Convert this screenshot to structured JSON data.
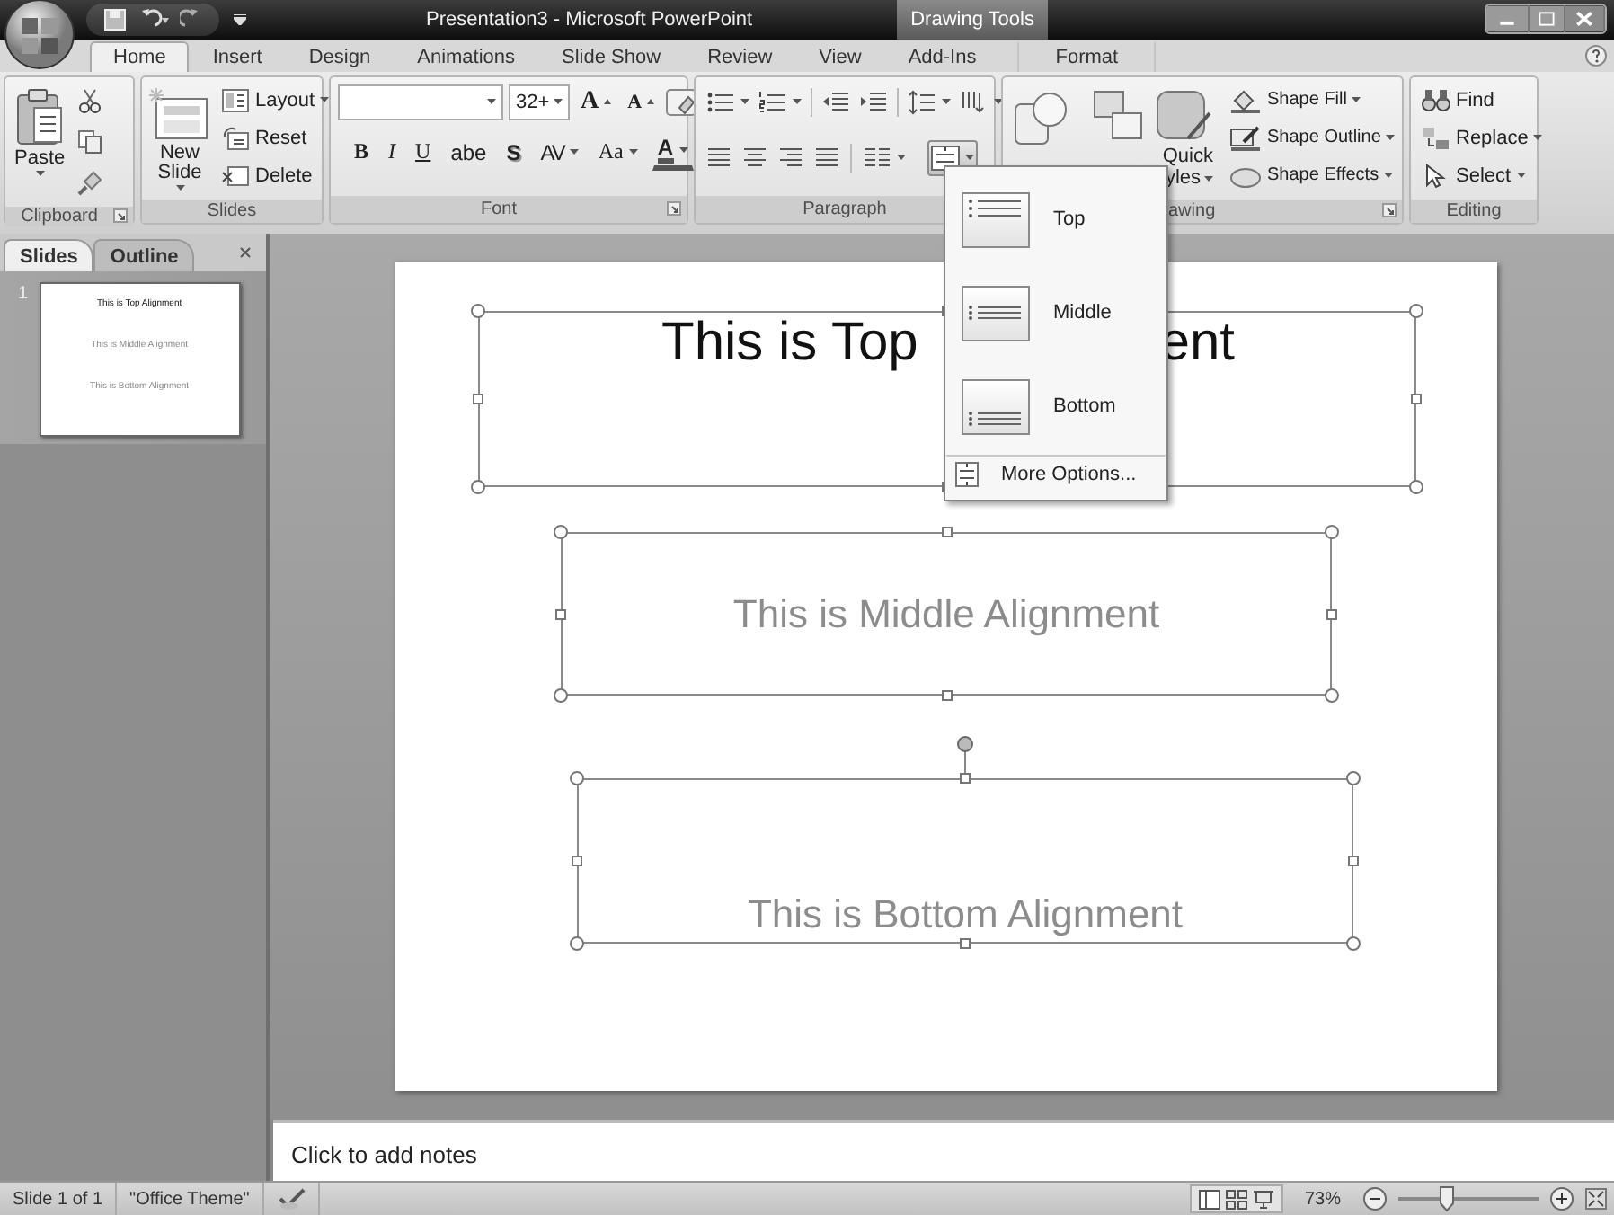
{
  "window": {
    "title": "Presentation3 - Microsoft PowerPoint",
    "context_tab": "Drawing Tools"
  },
  "tabs": [
    {
      "label": "Home",
      "selected": true,
      "contextual": false
    },
    {
      "label": "Insert",
      "selected": false,
      "contextual": false
    },
    {
      "label": "Design",
      "selected": false,
      "contextual": false
    },
    {
      "label": "Animations",
      "selected": false,
      "contextual": false
    },
    {
      "label": "Slide Show",
      "selected": false,
      "contextual": false
    },
    {
      "label": "Review",
      "selected": false,
      "contextual": false
    },
    {
      "label": "View",
      "selected": false,
      "contextual": false
    },
    {
      "label": "Add-Ins",
      "selected": false,
      "contextual": false
    },
    {
      "label": "Format",
      "selected": false,
      "contextual": true
    }
  ],
  "ribbon": {
    "groups": [
      {
        "kind": "clipboard",
        "label": "Clipboard",
        "paste": "Paste"
      },
      {
        "kind": "slides",
        "label": "Slides",
        "new_slide": "New Slide",
        "commands": [
          "Layout",
          "Reset",
          "Delete"
        ]
      },
      {
        "kind": "font",
        "label": "Font",
        "font_size": "32+",
        "size_buttons": [
          "A",
          "A"
        ],
        "format_buttons": [
          "B",
          "I",
          "U",
          "abe",
          "S",
          "AV",
          "Aa",
          "A"
        ]
      },
      {
        "kind": "paragraph",
        "label": "Paragraph",
        "align_text_expanded": true
      },
      {
        "kind": "drawing",
        "label": "awing",
        "quick_styles": [
          "Quick",
          "yles"
        ],
        "commands": [
          "Shape Fill",
          "Shape Outline",
          "Shape Effects"
        ]
      },
      {
        "kind": "editing",
        "label": "Editing",
        "commands": [
          "Find",
          "Replace",
          "Select"
        ]
      }
    ]
  },
  "align_menu": {
    "items": [
      {
        "kind": "top",
        "label": "Top"
      },
      {
        "kind": "middle",
        "label": "Middle"
      },
      {
        "kind": "bottom",
        "label": "Bottom"
      }
    ],
    "more": "More Options..."
  },
  "slides_panel": {
    "tabs": [
      {
        "label": "Slides",
        "selected": true
      },
      {
        "label": "Outline",
        "selected": false
      }
    ],
    "thumbnails": [
      {
        "number": "1",
        "texts": [
          "This is Top Alignment",
          "This is Middle Alignment",
          "This is Bottom Alignment"
        ]
      }
    ]
  },
  "slide": {
    "text_boxes": [
      {
        "kind": "top",
        "texts": [
          "This is Top",
          "ent"
        ],
        "dimmed": false
      },
      {
        "kind": "middle",
        "texts": [
          "This is Middle Alignment"
        ],
        "dimmed": true,
        "rotation_handle": false
      },
      {
        "kind": "bottom",
        "texts": [
          "This is Bottom Alignment"
        ],
        "dimmed": true,
        "rotation_handle": true
      }
    ]
  },
  "notes": {
    "placeholder": "Click to add notes"
  },
  "status_bar": {
    "slide": "Slide 1 of 1",
    "theme": "\"Office Theme\"",
    "zoom": {
      "reading": "73%",
      "level": 0.35
    }
  }
}
